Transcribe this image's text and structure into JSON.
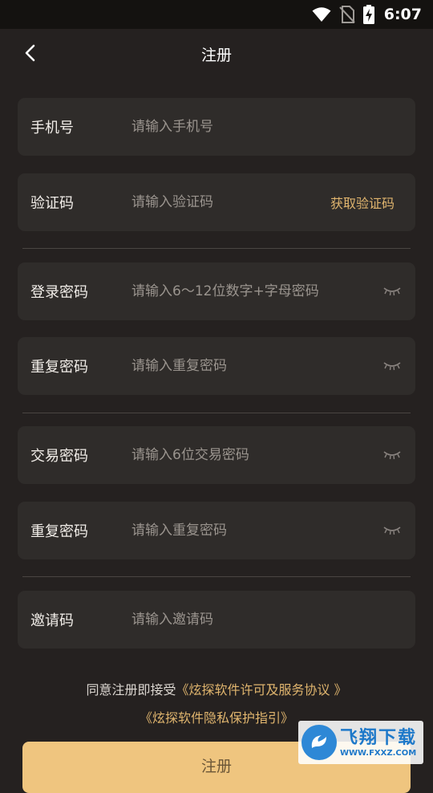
{
  "status_bar": {
    "time": "6:07",
    "icons": [
      "wifi-icon",
      "no-sim-icon",
      "battery-charging-icon"
    ]
  },
  "nav": {
    "title": "注册",
    "back_icon": "chevron-left-icon"
  },
  "fields": {
    "phone": {
      "label": "手机号",
      "placeholder": "请输入手机号"
    },
    "code": {
      "label": "验证码",
      "placeholder": "请输入验证码",
      "action": "获取验证码"
    },
    "login_password": {
      "label": "登录密码",
      "placeholder": "请输入6～12位数字+字母密码",
      "icon": "eye-closed-icon"
    },
    "login_password_repeat": {
      "label": "重复密码",
      "placeholder": "请输入重复密码",
      "icon": "eye-closed-icon"
    },
    "trade_password": {
      "label": "交易密码",
      "placeholder": "请输入6位交易密码",
      "icon": "eye-closed-icon"
    },
    "trade_password_repeat": {
      "label": "重复密码",
      "placeholder": "请输入重复密码",
      "icon": "eye-closed-icon"
    },
    "invite": {
      "label": "邀请码",
      "placeholder": "请输入邀请码"
    }
  },
  "agreement": {
    "prefix": "同意注册即接受",
    "license_link": "《炫探软件许可及服务协议 》",
    "privacy_link": "《炫探软件隐私保护指引》"
  },
  "submit_label": "注册",
  "watermark": {
    "name": "飞翔下载",
    "url": "WWW.FXXZ.COM"
  },
  "colors": {
    "background": "#252120",
    "field": "#2f2c2a",
    "accent": "#e0b56e",
    "button": "#efc57f"
  }
}
